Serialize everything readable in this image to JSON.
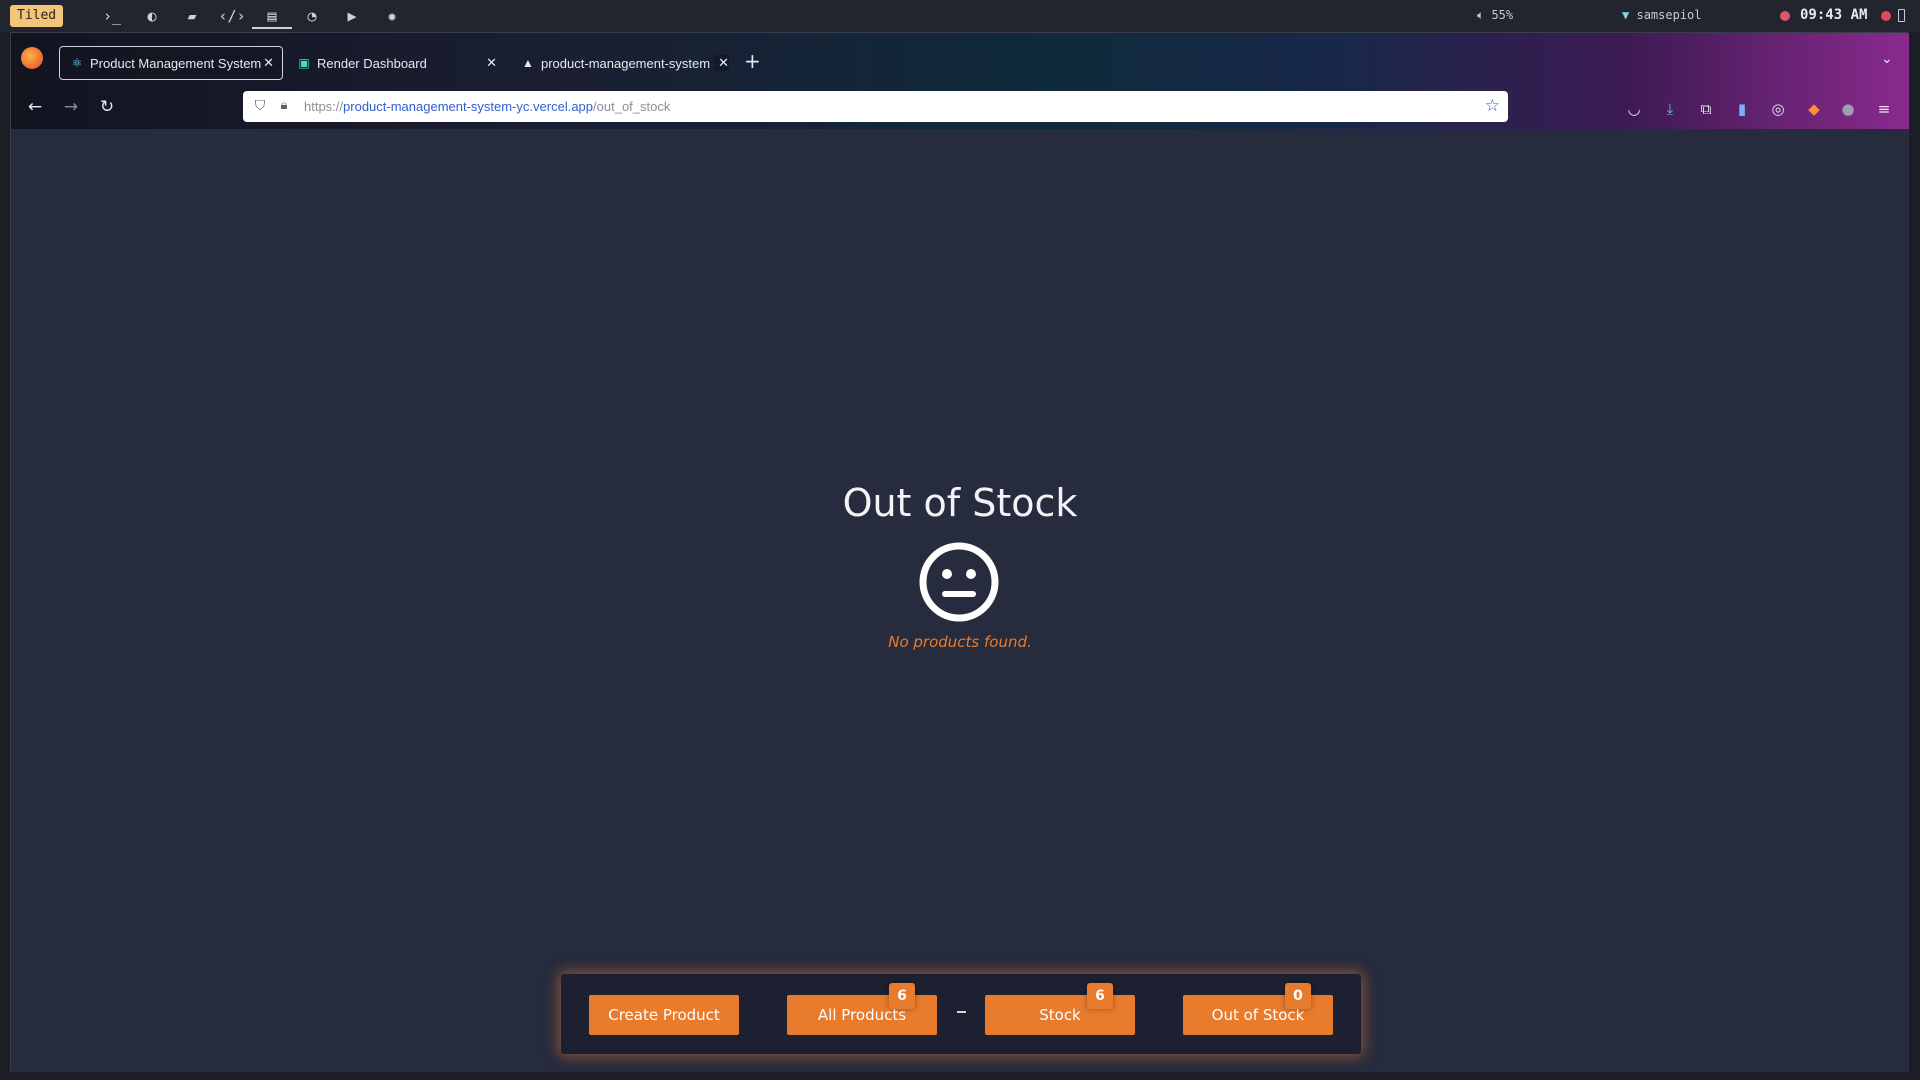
{
  "system_bar": {
    "layout_label": "Tiled",
    "workspace_icons": [
      "terminal-icon",
      "firefox-icon",
      "folder-icon",
      "code-icon",
      "notes-icon",
      "chat-icon",
      "youtube-icon",
      "settings-icon"
    ],
    "volume": "55%",
    "network": "samsepiol",
    "clock": "09:43 AM"
  },
  "browser": {
    "tabs": [
      {
        "title": "Product Management System",
        "icon": "react-icon",
        "active": true
      },
      {
        "title": "Render Dashboard",
        "icon": "render-icon",
        "active": false
      },
      {
        "title": "product-management-system",
        "icon": "vercel-icon",
        "active": false
      }
    ],
    "url": {
      "scheme": "https://",
      "host": "product-management-system-yc.vercel.app",
      "path": "/out_of_stock"
    }
  },
  "page": {
    "title": "Out of Stock",
    "empty_message": "No products found.",
    "nav_buttons": [
      {
        "label": "Create Product",
        "badge": null
      },
      {
        "label": "All Products",
        "badge": "6"
      },
      {
        "label": "Stock",
        "badge": "6"
      },
      {
        "label": "Out of Stock",
        "badge": "0"
      }
    ]
  },
  "colors": {
    "accent": "#e87b2c",
    "page_background": "#272b3e",
    "nav_background": "#1d2030"
  }
}
